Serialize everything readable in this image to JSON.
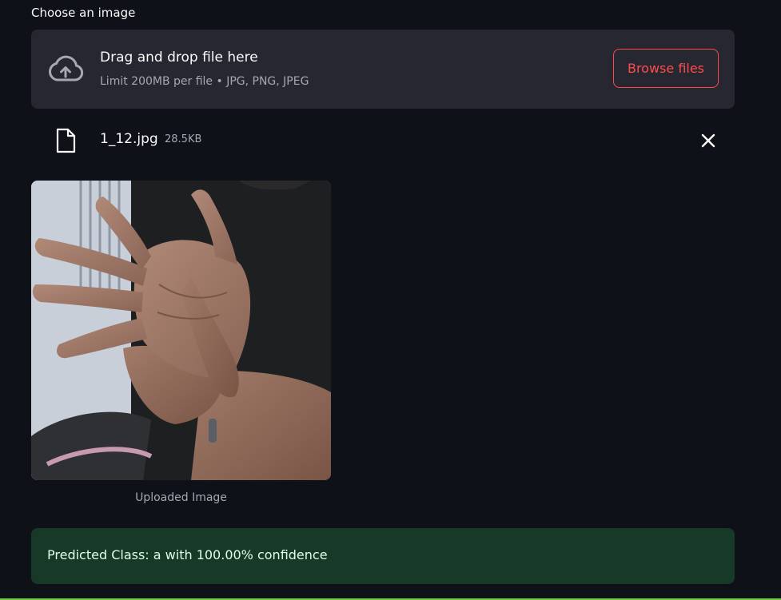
{
  "uploader": {
    "label": "Choose an image",
    "dropzone_title": "Drag and drop file here",
    "dropzone_hint": "Limit 200MB per file • JPG, PNG, JPEG",
    "browse_label": "Browse files",
    "cloud_icon": "cloud-upload-icon"
  },
  "file": {
    "name": "1_12.jpg",
    "size": "28.5KB",
    "file_icon": "file-icon",
    "remove_icon": "close-icon"
  },
  "image": {
    "caption": "Uploaded Image"
  },
  "result": {
    "text": "Predicted Class: a with 100.00% confidence"
  },
  "colors": {
    "background": "#0e1117",
    "surface": "#262730",
    "accent": "#ff4b4b",
    "success_bg": "#173928",
    "success_text": "#dffde9"
  }
}
